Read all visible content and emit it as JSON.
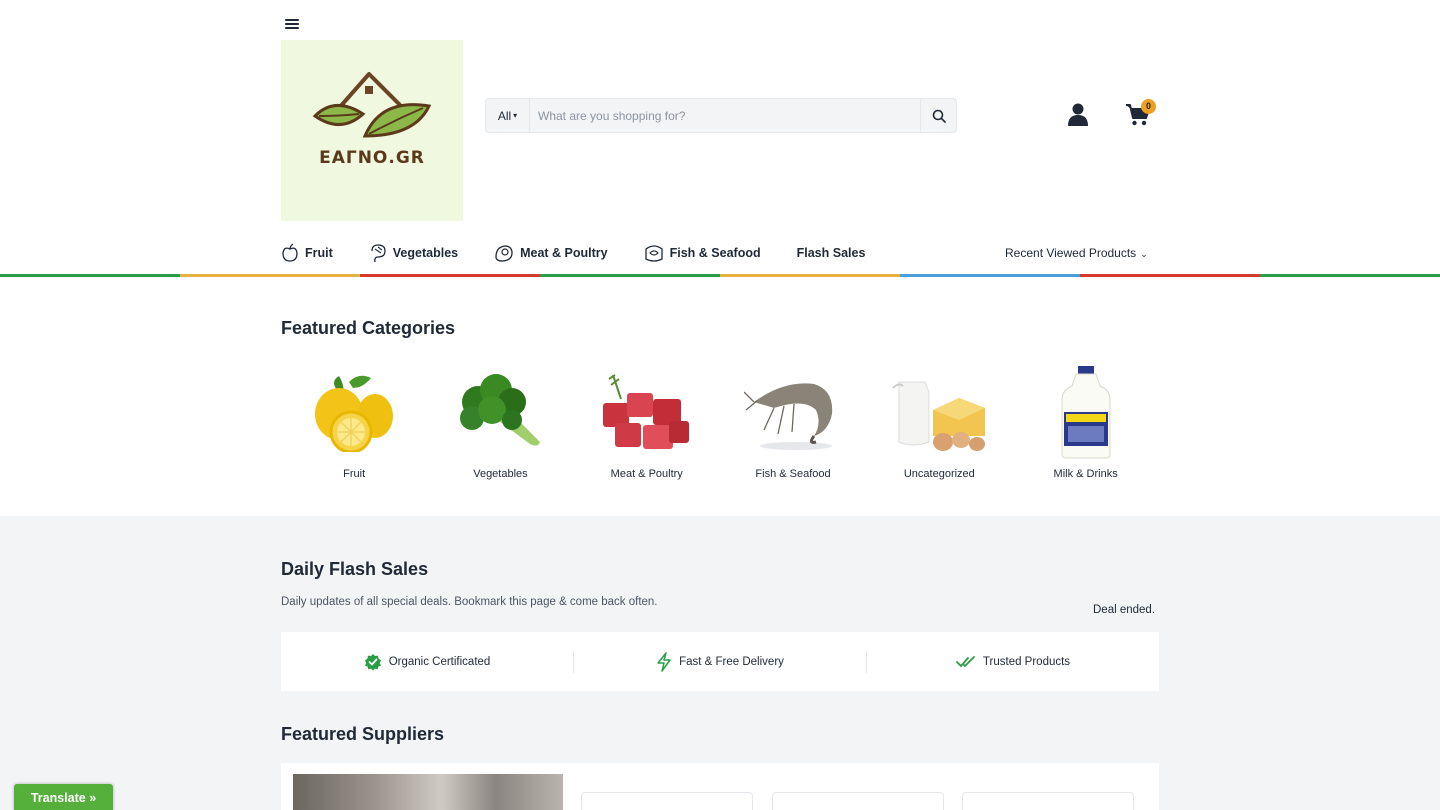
{
  "logo": {
    "text": "ΕΑΓΝΟ.GR"
  },
  "search": {
    "category": "All",
    "placeholder": "What are you shopping for?"
  },
  "cart": {
    "count": "0"
  },
  "nav": {
    "items": [
      {
        "label": "Fruit",
        "icon": "apple-icon"
      },
      {
        "label": "Vegetables",
        "icon": "vegetables-icon"
      },
      {
        "label": "Meat & Poultry",
        "icon": "meat-icon"
      },
      {
        "label": "Fish & Seafood",
        "icon": "fish-icon"
      },
      {
        "label": "Flash Sales",
        "icon": ""
      }
    ],
    "recent": "Recent Viewed Products"
  },
  "stripe_colors": [
    "#2a9d46",
    "#e8b040",
    "#d63a2f",
    "#2a9d46",
    "#e8b040",
    "#4a9fd8",
    "#d63a2f",
    "#2a9d46"
  ],
  "featured": {
    "title": "Featured Categories",
    "categories": [
      {
        "label": "Fruit"
      },
      {
        "label": "Vegetables"
      },
      {
        "label": "Meat & Poultry"
      },
      {
        "label": "Fish & Seafood"
      },
      {
        "label": "Uncategorized"
      },
      {
        "label": "Milk & Drinks"
      }
    ]
  },
  "flash": {
    "title": "Daily Flash Sales",
    "subtitle": "Daily updates of all special deals. Bookmark this page & come back often.",
    "status": "Deal ended."
  },
  "features": [
    {
      "label": "Organic Certificated",
      "icon": "certified-badge-icon"
    },
    {
      "label": "Fast & Free Delivery",
      "icon": "lightning-icon"
    },
    {
      "label": "Trusted Products",
      "icon": "double-check-icon"
    }
  ],
  "suppliers": {
    "title": "Featured Suppliers"
  },
  "translate": {
    "label": "Translate »"
  },
  "colors": {
    "accent_green": "#2a9d46",
    "badge": "#f0a020",
    "translate_bg": "#55b03b"
  }
}
